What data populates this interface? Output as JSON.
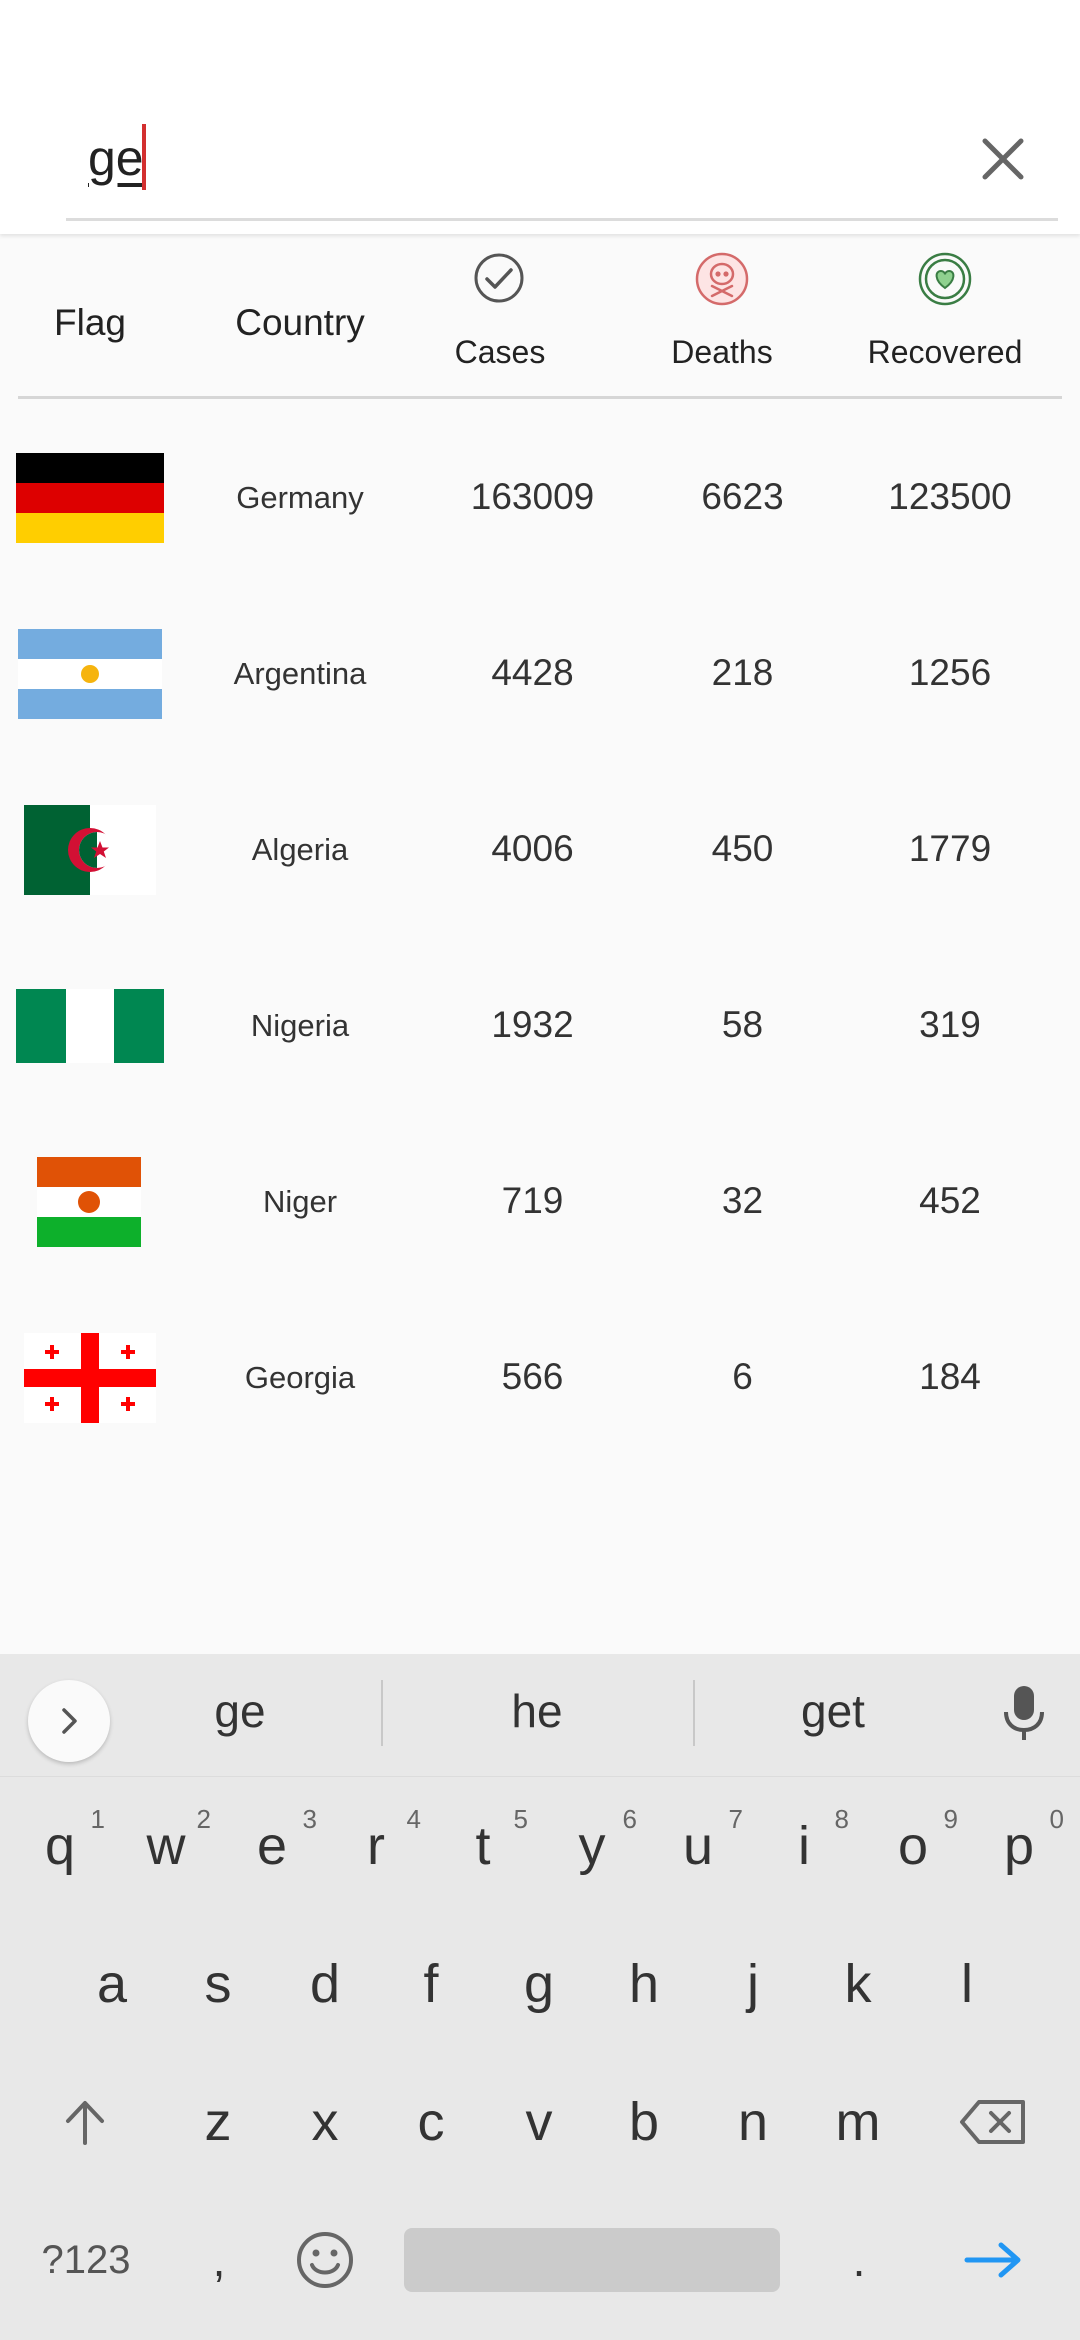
{
  "search": {
    "value": "ge",
    "clear_icon": "close-icon"
  },
  "table": {
    "headers": {
      "flag": "Flag",
      "country": "Country",
      "cases": "Cases",
      "deaths": "Deaths",
      "recovered": "Recovered"
    },
    "header_icons": {
      "cases": "check-circle-icon",
      "deaths": "skull-icon",
      "recovered": "heart-shield-icon"
    },
    "rows": [
      {
        "flag": "germany-flag-icon",
        "country": "Germany",
        "cases": "163009",
        "deaths": "6623",
        "recovered": "123500"
      },
      {
        "flag": "argentina-flag-icon",
        "country": "Argentina",
        "cases": "4428",
        "deaths": "218",
        "recovered": "1256"
      },
      {
        "flag": "algeria-flag-icon",
        "country": "Algeria",
        "cases": "4006",
        "deaths": "450",
        "recovered": "1779"
      },
      {
        "flag": "nigeria-flag-icon",
        "country": "Nigeria",
        "cases": "1932",
        "deaths": "58",
        "recovered": "319"
      },
      {
        "flag": "niger-flag-icon",
        "country": "Niger",
        "cases": "719",
        "deaths": "32",
        "recovered": "452"
      },
      {
        "flag": "georgia-flag-icon",
        "country": "Georgia",
        "cases": "566",
        "deaths": "6",
        "recovered": "184"
      }
    ]
  },
  "keyboard": {
    "suggestions": [
      "ge",
      "he",
      "get"
    ],
    "row1": [
      "q",
      "w",
      "e",
      "r",
      "t",
      "y",
      "u",
      "i",
      "o",
      "p"
    ],
    "row1_hints": [
      "1",
      "2",
      "3",
      "4",
      "5",
      "6",
      "7",
      "8",
      "9",
      "0"
    ],
    "row2": [
      "a",
      "s",
      "d",
      "f",
      "g",
      "h",
      "j",
      "k",
      "l"
    ],
    "row3": [
      "z",
      "x",
      "c",
      "v",
      "b",
      "n",
      "m"
    ],
    "symbols_label": "?123",
    "comma": ",",
    "period": "."
  },
  "colors": {
    "accent_red": "#d32f2f",
    "keyboard_bg": "#e8e8e8",
    "enter_blue": "#2196f3"
  }
}
